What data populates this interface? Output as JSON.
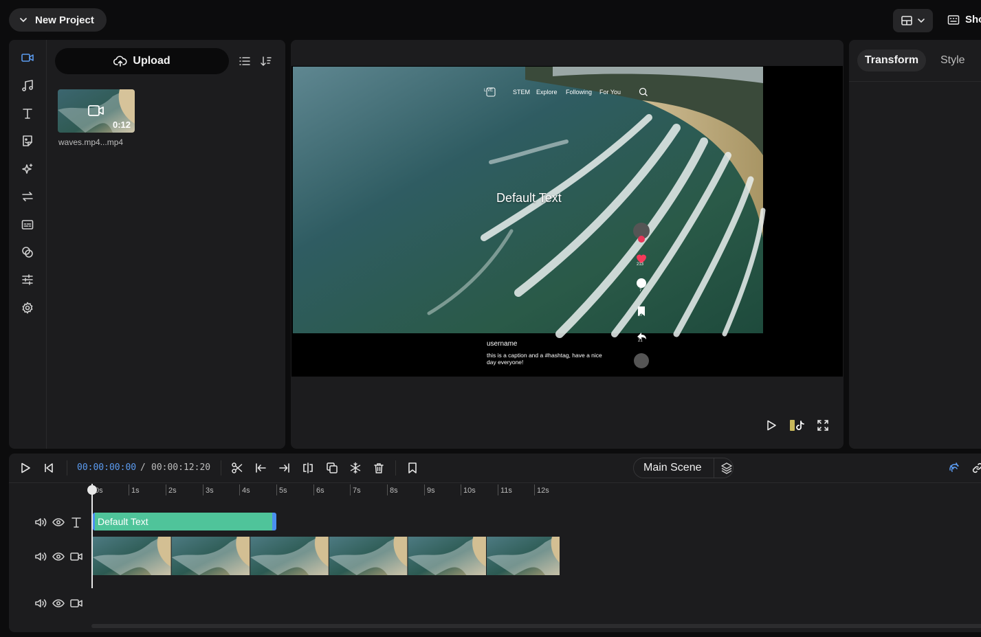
{
  "header": {
    "project_label": "New Project",
    "show_label": "Show"
  },
  "left_panel": {
    "rail_icons": [
      "video-icon",
      "music-icon",
      "text-icon",
      "sticker-icon",
      "effects-icon",
      "transition-icon",
      "captions-icon",
      "shapes-icon",
      "adjust-icon",
      "settings-icon"
    ],
    "upload_label": "Upload",
    "media": [
      {
        "name": "waves.mp4...mp4",
        "duration": "0:12"
      }
    ]
  },
  "preview": {
    "overlay_text": "Default Text",
    "nav": {
      "live": "LIVE",
      "items": [
        "STEM",
        "Explore",
        "Following",
        "For You"
      ]
    },
    "username": "username",
    "caption": "this is a caption and a #hashtag, have a nice day everyone!",
    "like_count": "213",
    "comment_count": "7",
    "bookmark_count": "57",
    "share_count": "21"
  },
  "right_panel": {
    "tabs": [
      "Transform",
      "Style"
    ],
    "active_tab": "Transform"
  },
  "timeline": {
    "current_time": "00:00:00:00",
    "separator": "/",
    "total_time": "00:00:12:20",
    "scene_label": "Main Scene",
    "ruler": [
      "0s",
      "1s",
      "2s",
      "3s",
      "4s",
      "5s",
      "6s",
      "7s",
      "8s",
      "9s",
      "10s",
      "11s",
      "12s"
    ],
    "text_clip_label": "Default Text",
    "accent_color": "#5b9bf0",
    "text_clip_color": "#4fc49a"
  }
}
